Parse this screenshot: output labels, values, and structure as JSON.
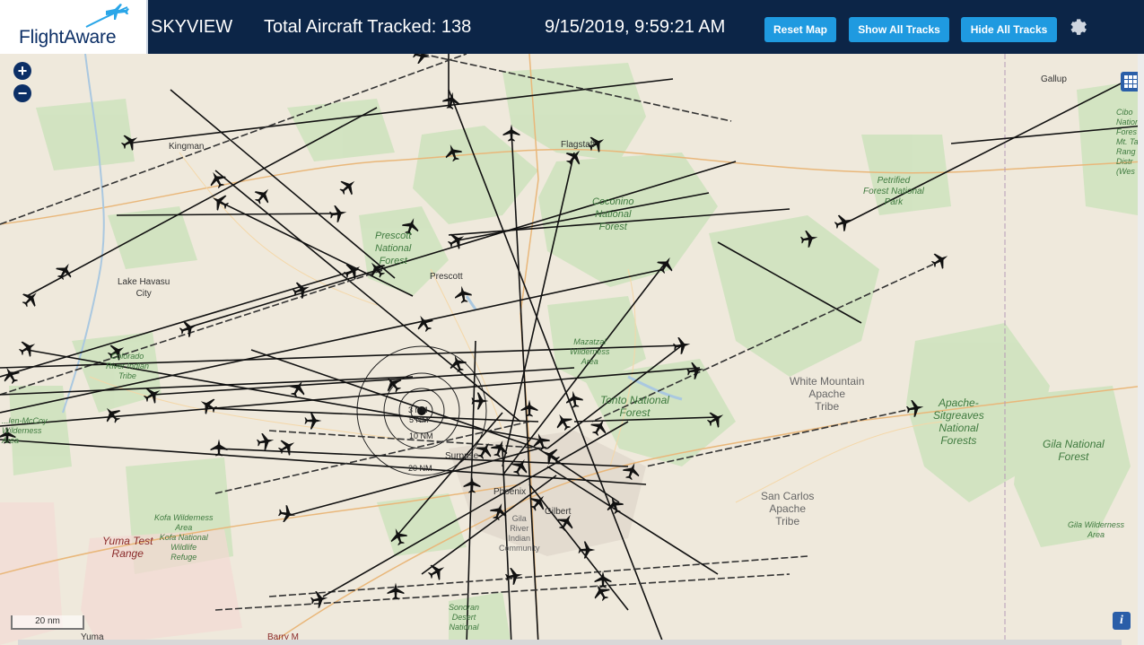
{
  "header": {
    "logo_text": "FlightAware",
    "app_title": "SKYVIEW",
    "aircraft_count": "Total Aircraft Tracked: 138",
    "datetime": "9/15/2019, 9:59:21 AM",
    "buttons": {
      "reset_map": "Reset Map",
      "show_all_tracks": "Show All Tracks",
      "hide_all_tracks": "Hide All Tracks"
    }
  },
  "map": {
    "zoom_in": "+",
    "zoom_out": "−",
    "scale_label": "20 nm",
    "info": "i",
    "range_rings": [
      "3 NM",
      "5 NM",
      "10 NM",
      "20 NM"
    ],
    "cities": {
      "kingman": "Kingman",
      "lake_havasu": "Lake Havasu\nCity",
      "prescott": "Prescott",
      "flagstaff": "Flagstaff",
      "gallup": "Gallup",
      "surprise": "Surprise",
      "phoenix": "Phoenix",
      "gilbert": "Gilbert",
      "yuma": "Yuma",
      "barry_m": "Barry M"
    },
    "forests": {
      "prescott_nf": "Prescott\nNational\nForest",
      "coconino_nf": "Coconino\nNational\nForest",
      "petrified": "Petrified\nForest National\nPark",
      "tonto_nf": "Tonto National\nForest",
      "mazatzal": "Mazatzal\nWilderness\nArea",
      "apache_sitgreaves": "Apache-\nSitgreaves\nNational\nForests",
      "gila_nf": "Gila National\nForest",
      "gila_wilderness": "Gila Wilderness\nArea",
      "cibola": "Cibo\nNational\nFores\nMt. Ta\nRang\nDistr\n(Wes",
      "kofa": "Kofa Wilderness\nArea\nKofa National\nWildlife\nRefuge",
      "colorado_river": "Colorado\nRiver Indian\nTribe",
      "sonoran": "Sonoran\nDesert\nNational",
      "swansea": "...len-McCoy\nWilderness\nArea"
    },
    "tribes": {
      "white_mountain": "White Mountain\nApache\nTribe",
      "san_carlos": "San Carlos\nApache\nTribe",
      "gila_river": "Gila\nRiver\nIndian\nCommunity"
    },
    "ranges": {
      "yuma_test": "Yuma Test\nRange"
    }
  },
  "colors": {
    "header_bg": "#0c2547",
    "button_bg": "#1f9ae0",
    "map_bg": "#efe9dc",
    "forest_green": "#cfe3bf",
    "track": "#111111"
  }
}
